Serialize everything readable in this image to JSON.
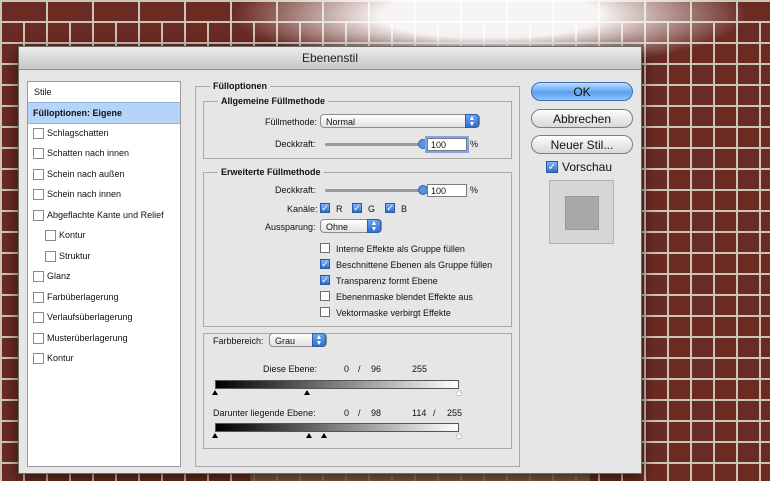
{
  "window": {
    "title": "Ebenenstil"
  },
  "sidebar": {
    "header": "Stile",
    "items": [
      {
        "label": "Fülloptionen: Eigene",
        "selected": true,
        "checkbox": false,
        "indent": 0
      },
      {
        "label": "Schlagschatten",
        "checkbox": true,
        "indent": 0
      },
      {
        "label": "Schatten nach innen",
        "checkbox": true,
        "indent": 0
      },
      {
        "label": "Schein nach außen",
        "checkbox": true,
        "indent": 0
      },
      {
        "label": "Schein nach innen",
        "checkbox": true,
        "indent": 0
      },
      {
        "label": "Abgeflachte Kante und Relief",
        "checkbox": true,
        "indent": 0
      },
      {
        "label": "Kontur",
        "checkbox": true,
        "indent": 1
      },
      {
        "label": "Struktur",
        "checkbox": true,
        "indent": 1
      },
      {
        "label": "Glanz",
        "checkbox": true,
        "indent": 0
      },
      {
        "label": "Farbüberlagerung",
        "checkbox": true,
        "indent": 0
      },
      {
        "label": "Verlaufsüberlagerung",
        "checkbox": true,
        "indent": 0
      },
      {
        "label": "Musterüberlagerung",
        "checkbox": true,
        "indent": 0
      },
      {
        "label": "Kontur",
        "checkbox": true,
        "indent": 0
      }
    ]
  },
  "blending": {
    "section_title": "Fülloptionen",
    "general": {
      "title": "Allgemeine Füllmethode",
      "mode_label": "Füllmethode:",
      "mode_value": "Normal",
      "opacity_label": "Deckkraft:",
      "opacity_value": "100",
      "opacity_fraction": 1.0,
      "unit": "%"
    },
    "advanced": {
      "title": "Erweiterte Füllmethode",
      "fill_label": "Deckkraft:",
      "fill_value": "100",
      "fill_fraction": 1.0,
      "unit": "%",
      "channels_label": "Kanäle:",
      "channels": [
        {
          "label": "R",
          "checked": true
        },
        {
          "label": "G",
          "checked": true
        },
        {
          "label": "B",
          "checked": true
        }
      ],
      "knockout_label": "Aussparung:",
      "knockout_value": "Ohne",
      "options": [
        {
          "label": "Interne Effekte als Gruppe füllen",
          "checked": false
        },
        {
          "label": "Beschnittene Ebenen als Gruppe füllen",
          "checked": true
        },
        {
          "label": "Transparenz formt Ebene",
          "checked": true
        },
        {
          "label": "Ebenenmaske blendet Effekte aus",
          "checked": false
        },
        {
          "label": "Vektormaske verbirgt Effekte",
          "checked": false
        }
      ]
    },
    "blend_if": {
      "label": "Farbbereich:",
      "value": "Grau",
      "this_layer": {
        "label": "Diese Ebene:",
        "v1": "0",
        "sep": "/",
        "v2": "96",
        "v3": "255",
        "values": [
          0,
          96,
          255
        ]
      },
      "underlying": {
        "label": "Darunter liegende Ebene:",
        "v1": "0",
        "sep1": "/",
        "v2": "98",
        "v3": "114",
        "sep2": "/",
        "v4": "255",
        "values": [
          0,
          98,
          114,
          255
        ]
      }
    }
  },
  "buttons": {
    "ok": "OK",
    "cancel": "Abbrechen",
    "new_style": "Neuer Stil...",
    "preview_label": "Vorschau",
    "preview_checked": true
  }
}
